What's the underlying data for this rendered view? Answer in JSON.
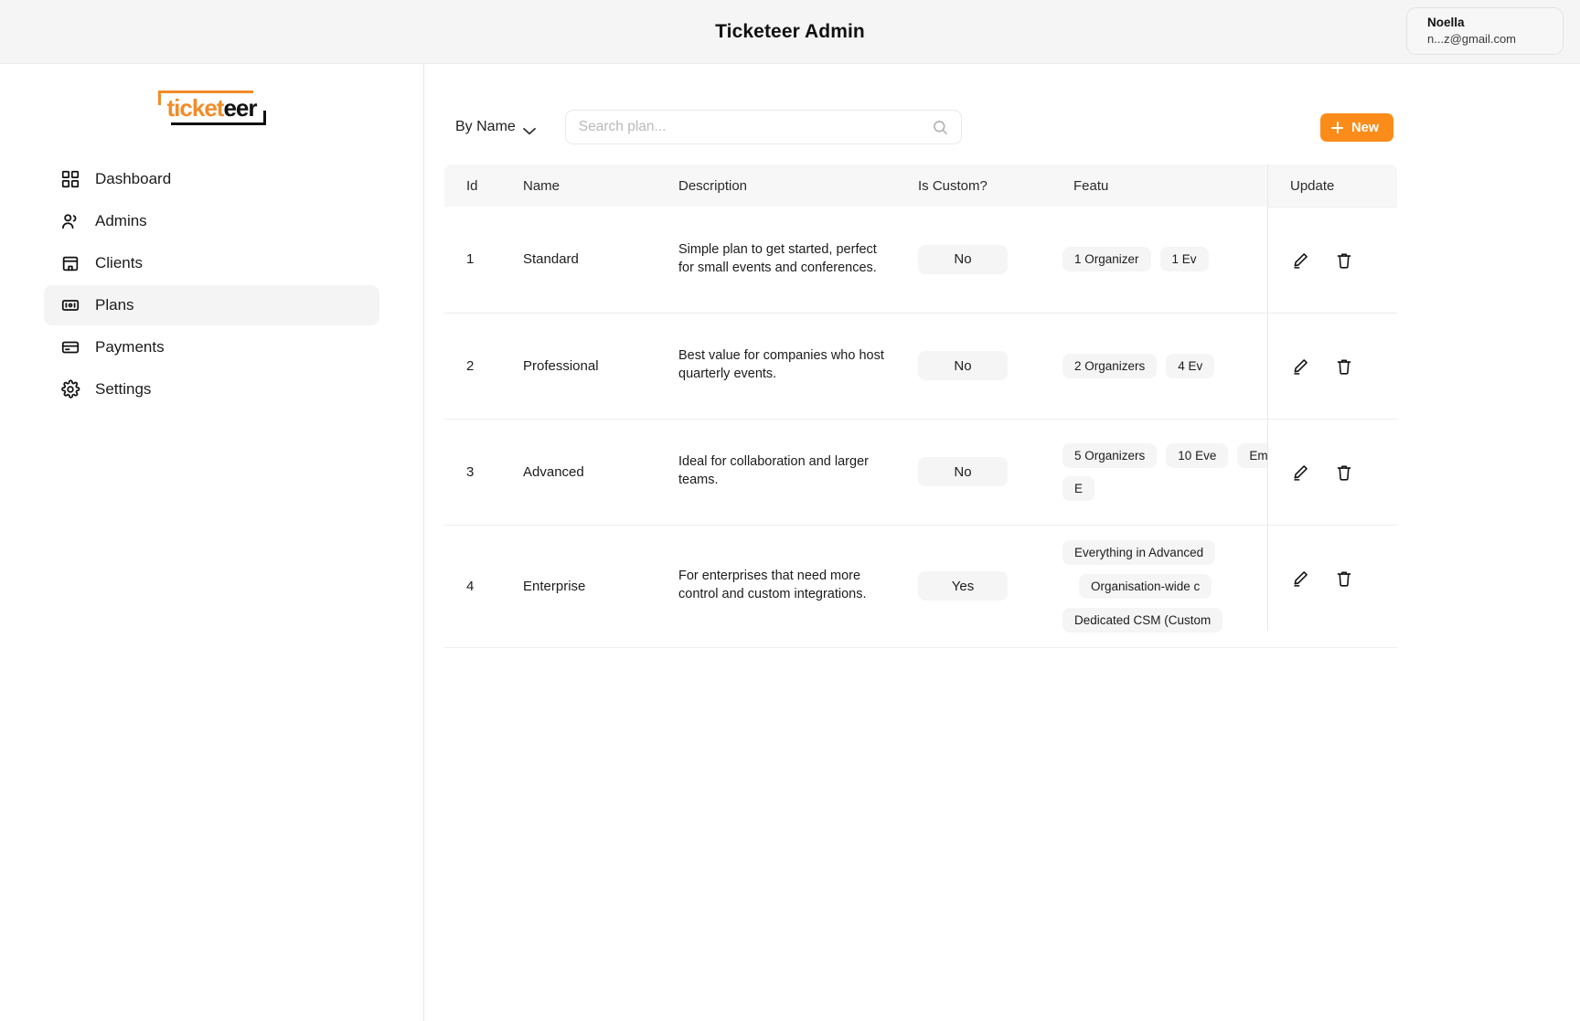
{
  "header": {
    "title": "Ticketeer Admin",
    "account": {
      "name": "Noella",
      "email": "n...z@gmail.com"
    }
  },
  "sidebar": {
    "logo": {
      "part1": "ticket",
      "part2": "eer"
    },
    "items": [
      {
        "label": "Dashboard",
        "icon": "grid-icon",
        "active": false
      },
      {
        "label": "Admins",
        "icon": "users-icon",
        "active": false
      },
      {
        "label": "Clients",
        "icon": "building-icon",
        "active": false
      },
      {
        "label": "Plans",
        "icon": "ticket-icon",
        "active": true
      },
      {
        "label": "Payments",
        "icon": "card-icon",
        "active": false
      },
      {
        "label": "Settings",
        "icon": "gear-icon",
        "active": false
      }
    ]
  },
  "toolbar": {
    "sort_label": "By Name",
    "search_placeholder": "Search plan...",
    "search_value": "",
    "new_label": "New"
  },
  "table": {
    "columns": [
      "Id",
      "Name",
      "Description",
      "Is Custom?",
      "Features",
      "Update"
    ],
    "features_header_truncated": "Featu",
    "rows": [
      {
        "id": "1",
        "name": "Standard",
        "description": "Simple plan to get started, perfect for small events and conferences.",
        "is_custom": "No",
        "features": [
          "1 Organizer",
          "1 Ev"
        ]
      },
      {
        "id": "2",
        "name": "Professional",
        "description": "Best value for companies who host quarterly events.",
        "is_custom": "No",
        "features": [
          "2 Organizers",
          "4 Ev"
        ]
      },
      {
        "id": "3",
        "name": "Advanced",
        "description": "Ideal for collaboration and larger teams.",
        "is_custom": "No",
        "features": [
          "5 Organizers",
          "10 Eve",
          "Email support",
          "E"
        ]
      },
      {
        "id": "4",
        "name": "Enterprise",
        "description": "For enterprises that need more control and custom integrations.",
        "is_custom": "Yes",
        "features": [
          "Everything in Advanced",
          "Organisation-wide c",
          "Dedicated CSM (Custom"
        ]
      }
    ],
    "actions": {
      "edit": "edit-icon",
      "delete": "delete-icon"
    }
  },
  "colors": {
    "accent": "#fb8c1a",
    "header_bg": "#f5f5f5",
    "pill_bg": "#f5f5f6"
  }
}
